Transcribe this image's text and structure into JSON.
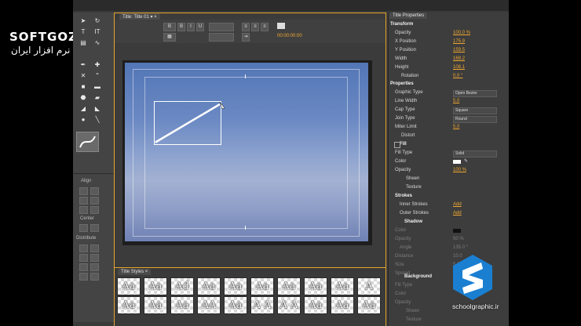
{
  "watermark": {
    "brand": "SOFTGOZAR.COM",
    "tagline": "اولین دانشنامه نرم افزار ایران"
  },
  "corner_brand": {
    "text": "schoolgraphic.ir"
  },
  "title_panel": {
    "tab_label": "Title: Title 01",
    "timecode": "00:00:00:00"
  },
  "tools": {
    "align_label": "Align",
    "center_label": "Center",
    "distribute_label": "Distribute"
  },
  "styles_panel": {
    "tab_label": "Title Styles",
    "swatches": [
      "Aa",
      "Aa",
      "Ad",
      "Aa",
      "Aa",
      "Aa",
      "Aa",
      "Aa",
      "Aa",
      "A",
      "Aa",
      "Aa",
      "Aa",
      "AA",
      "Aa",
      "A A",
      "A A",
      "Aa",
      "Aa",
      "Aa"
    ]
  },
  "properties": {
    "tab_label": "Title Properties",
    "transform": {
      "label": "Transform",
      "rows": [
        {
          "label": "Opacity",
          "value": "100.0 %"
        },
        {
          "label": "X Position",
          "value": "175.9"
        },
        {
          "label": "Y Position",
          "value": "159.5"
        },
        {
          "label": "Width",
          "value": "169.2"
        },
        {
          "label": "Height",
          "value": "108.1"
        },
        {
          "label": "Rotation",
          "value": "0.0 °"
        }
      ]
    },
    "props": {
      "label": "Properties",
      "graphic_type_label": "Graphic Type",
      "graphic_type_value": "Open Bezier",
      "line_width_label": "Line Width",
      "line_width_value": "5.0",
      "cap_type_label": "Cap Type",
      "cap_type_value": "Square",
      "join_type_label": "Join Type",
      "join_type_value": "Round",
      "miter_limit_label": "Miter Limit",
      "miter_limit_value": "5.0",
      "distort_label": "Distort"
    },
    "fill": {
      "label": "Fill",
      "fill_type_label": "Fill Type",
      "fill_type_value": "Solid",
      "color_label": "Color",
      "opacity_label": "Opacity",
      "opacity_value": "100 %",
      "sheen_label": "Sheen",
      "texture_label": "Texture"
    },
    "strokes": {
      "label": "Strokes",
      "inner_label": "Inner Strokes",
      "inner_value": "Add",
      "outer_label": "Outer Strokes",
      "outer_value": "Add"
    },
    "shadow": {
      "label": "Shadow",
      "color_label": "Color",
      "opacity_label": "Opacity",
      "opacity_value": "50 %",
      "angle_label": "Angle",
      "angle_value": "135.0 °",
      "distance_label": "Distance",
      "distance_value": "10.0",
      "size_label": "Size",
      "size_value": "5.0",
      "spread_label": "Spread"
    },
    "background": {
      "label": "Background",
      "fill_type_label": "Fill Type",
      "color_label": "Color",
      "opacity_label": "Opacity",
      "sheen_label": "Sheen",
      "texture_label": "Texture"
    }
  },
  "colors": {
    "accent": "#e7a52a",
    "value": "#f0a830"
  }
}
